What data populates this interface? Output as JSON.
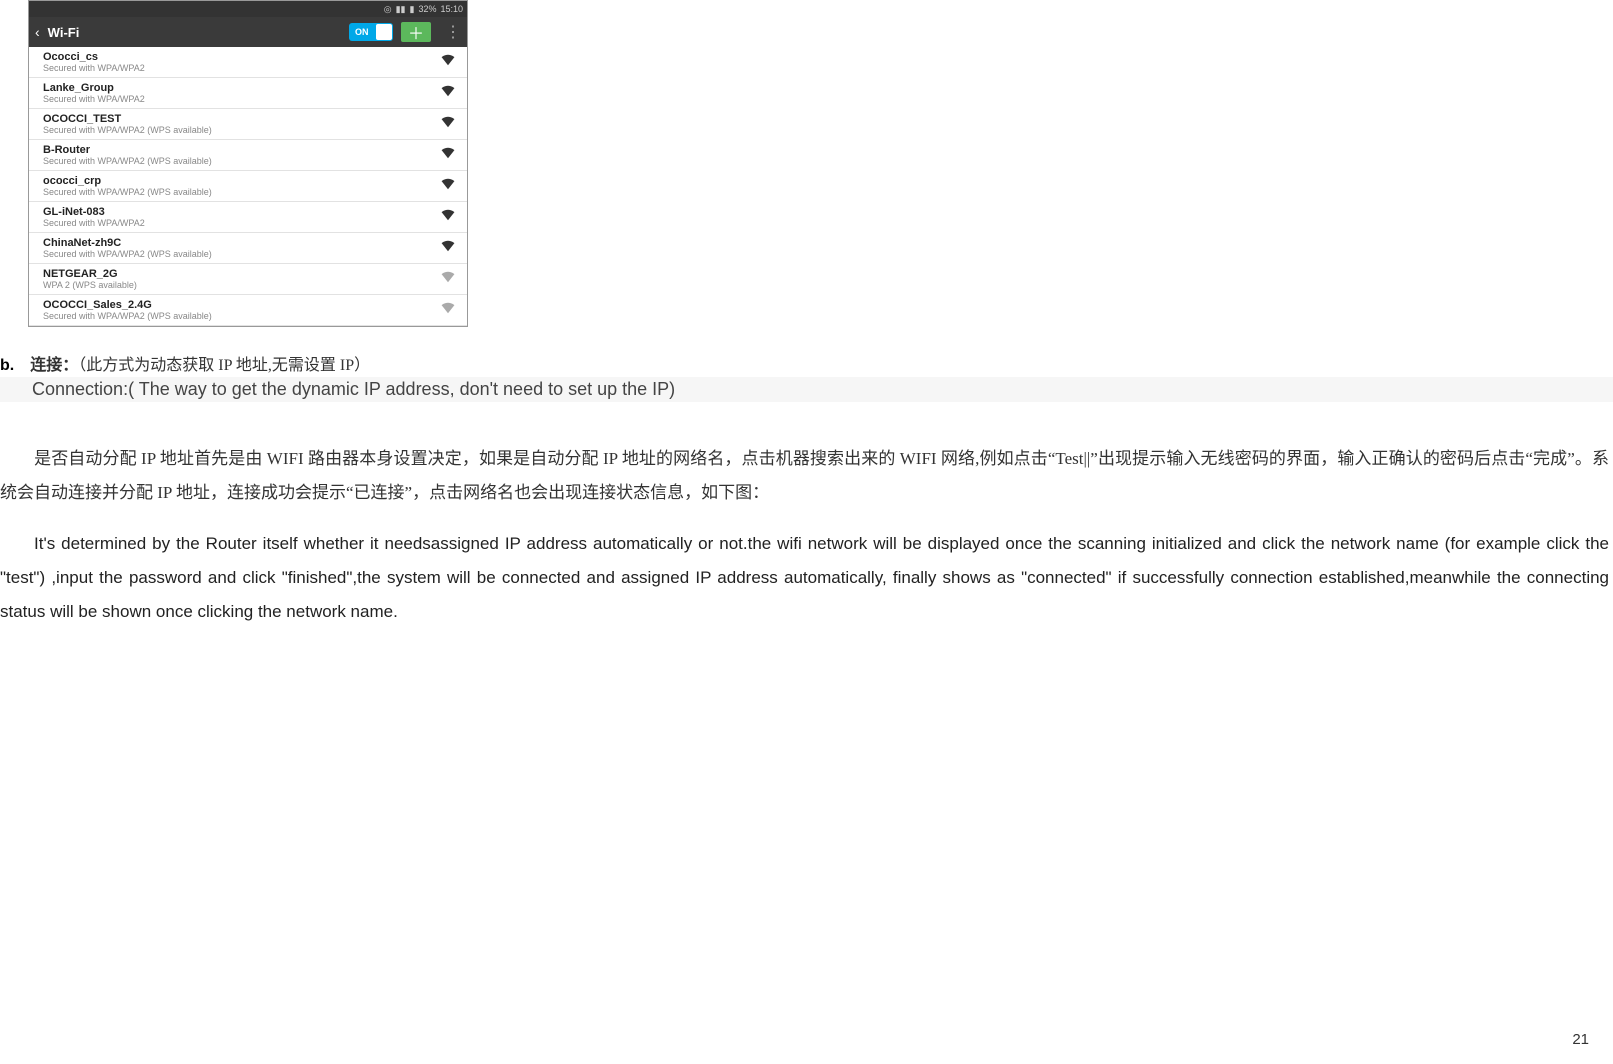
{
  "phone": {
    "status": {
      "battery": "32%",
      "time": "15:10",
      "alarm_icon": "◎",
      "signal_icon": "▮▮",
      "battery_icon": "▮"
    },
    "header": {
      "back_glyph": "‹",
      "title": "Wi-Fi",
      "toggle_label": "ON",
      "add_glyph": "＋",
      "menu_glyph": "⋮"
    },
    "networks": [
      {
        "name": "Ococci_cs",
        "sec": "Secured with WPA/WPA2",
        "strength": "full"
      },
      {
        "name": "Lanke_Group",
        "sec": "Secured with WPA/WPA2",
        "strength": "full"
      },
      {
        "name": "OCOCCI_TEST",
        "sec": "Secured with WPA/WPA2 (WPS available)",
        "strength": "full"
      },
      {
        "name": "B-Router",
        "sec": "Secured with WPA/WPA2 (WPS available)",
        "strength": "full"
      },
      {
        "name": "ococci_crp",
        "sec": "Secured with WPA/WPA2 (WPS available)",
        "strength": "mid"
      },
      {
        "name": "GL-iNet-083",
        "sec": "Secured with WPA/WPA2",
        "strength": "mid"
      },
      {
        "name": "ChinaNet-zh9C",
        "sec": "Secured with WPA/WPA2 (WPS available)",
        "strength": "mid"
      },
      {
        "name": "NETGEAR_2G",
        "sec": "WPA 2 (WPS available)",
        "strength": "weak"
      },
      {
        "name": "OCOCCI_Sales_2.4G",
        "sec": "Secured with WPA/WPA2 (WPS available)",
        "strength": "weak"
      }
    ]
  },
  "section_b": {
    "label": "b.",
    "cn_title_bold": "连接：",
    "cn_title_rest": "（此方式为动态获取 IP 地址,无需设置 IP）",
    "en_title_prefix": "Connection:( ",
    "en_title_rest": "The way to get the dynamic IP address, don't need to set up the IP)"
  },
  "paragraph_cn": "是否自动分配 IP 地址首先是由 WIFI 路由器本身设置决定，如果是自动分配 IP 地址的网络名，点击机器搜索出来的 WIFI 网络,例如点击“Test||”出现提示输入无线密码的界面，输入正确认的密码后点击“完成”。系统会自动连接并分配 IP 地址，连接成功会提示“已连接”，点击网络名也会出现连接状态信息，如下图：",
  "paragraph_en": "It's determined by the Router itself whether it needsassigned IP address automatically or not.the wifi network will be displayed once   the scanning initialized and click the network name (for example click the \"test\") ,input the password and click \"finished\",the system will be connected and assigned IP address automatically, finally shows as \"connected\" if successfully connection established,meanwhile the connecting status will be shown once clicking the network name.",
  "page_number": "21"
}
